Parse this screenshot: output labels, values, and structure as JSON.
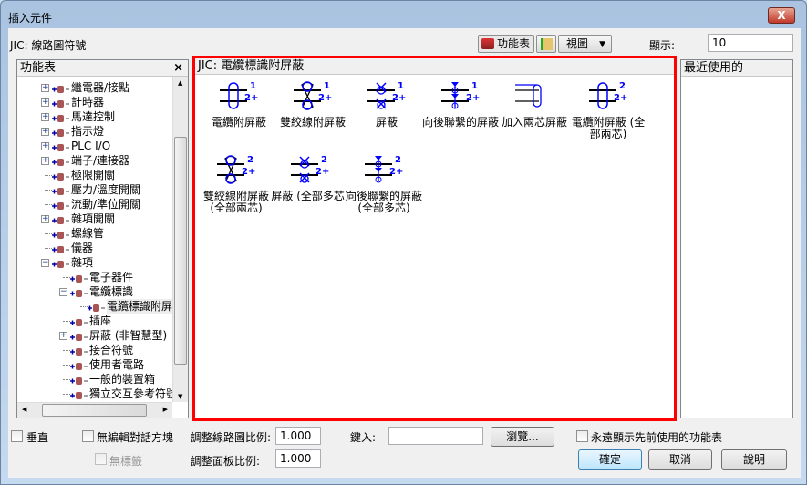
{
  "window": {
    "title": "插入元件",
    "close_label": "X"
  },
  "toolbar": {
    "library": "JIC: 線路圖符號",
    "menu_button": "功能表",
    "view_button": "視圖",
    "display_label": "顯示:",
    "display_value": "10"
  },
  "menu_panel": {
    "title": "功能表",
    "close": "×",
    "items": [
      {
        "label": "繼電器/接點",
        "level": 0,
        "expander": "+"
      },
      {
        "label": "計時器",
        "level": 0,
        "expander": "+"
      },
      {
        "label": "馬達控制",
        "level": 0,
        "expander": "+"
      },
      {
        "label": "指示燈",
        "level": 0,
        "expander": "+"
      },
      {
        "label": "PLC I/O",
        "level": 0,
        "expander": "+"
      },
      {
        "label": "端子/連接器",
        "level": 0,
        "expander": "+"
      },
      {
        "label": "極限開關",
        "level": 0,
        "expander": ""
      },
      {
        "label": "壓力/溫度開關",
        "level": 0,
        "expander": ""
      },
      {
        "label": "流動/準位開關",
        "level": 0,
        "expander": ""
      },
      {
        "label": "雜項開關",
        "level": 0,
        "expander": "+"
      },
      {
        "label": "螺線管",
        "level": 0,
        "expander": ""
      },
      {
        "label": "儀器",
        "level": 0,
        "expander": ""
      },
      {
        "label": "雜項",
        "level": 0,
        "expander": "−"
      },
      {
        "label": "電子器件",
        "level": 1,
        "expander": ""
      },
      {
        "label": "電纜標識",
        "level": 1,
        "expander": "−"
      },
      {
        "label": "電纜標識附屏",
        "level": 2,
        "expander": "",
        "selected": true
      },
      {
        "label": "插座",
        "level": 1,
        "expander": ""
      },
      {
        "label": "屏蔽 (非智慧型)",
        "level": 1,
        "expander": "+"
      },
      {
        "label": "接合符號",
        "level": 1,
        "expander": ""
      },
      {
        "label": "使用者電路",
        "level": 1,
        "expander": ""
      },
      {
        "label": "一般的裝置箱",
        "level": 1,
        "expander": ""
      },
      {
        "label": "獨立交互參考符號",
        "level": 1,
        "expander": ""
      }
    ]
  },
  "symbols_panel": {
    "title": "JIC: 電纜標識附屏蔽",
    "symbols": [
      {
        "label": "電纜附屏蔽",
        "icon": "shield-loop-1",
        "top": "1"
      },
      {
        "label": "雙絞線附屏蔽",
        "icon": "twisted-1",
        "top": "1"
      },
      {
        "label": "屏蔽",
        "icon": "shield-x-1",
        "top": "1"
      },
      {
        "label": "向後聯繫的屏蔽",
        "icon": "shield-tie-1",
        "top": "1"
      },
      {
        "label": "加入兩芯屏蔽",
        "icon": "add-shield",
        "top": ""
      },
      {
        "label": "電纜附屏蔽 (全部兩芯)",
        "icon": "shield-loop-2",
        "top": "2"
      },
      {
        "label": "雙絞線附屏蔽 (全部兩芯)",
        "icon": "twisted-2",
        "top": "2"
      },
      {
        "label": "屏蔽 (全部多芯)",
        "icon": "shield-x-2",
        "top": "2"
      },
      {
        "label": "向後聯繫的屏蔽 (全部多芯)",
        "icon": "shield-tie-2",
        "top": "2"
      }
    ],
    "bottom_label": "2+"
  },
  "recent_panel": {
    "title": "最近使用的"
  },
  "footer": {
    "vertical": "垂直",
    "no_edit_dialog": "無編輯對話方塊",
    "no_tag": "無標籤",
    "schematic_scale_label": "調整線路圖比例:",
    "schematic_scale": "1.000",
    "panel_scale_label": "調整面板比例:",
    "panel_scale": "1.000",
    "type_label": "鍵入:",
    "type_value": "",
    "browse": "瀏覽...",
    "always_show": "永遠顯示先前使用的功能表",
    "ok": "確定",
    "cancel": "取消",
    "help": "說明"
  },
  "colors": {
    "highlight": "#ff0000",
    "symbol_blue": "#0000ff"
  }
}
